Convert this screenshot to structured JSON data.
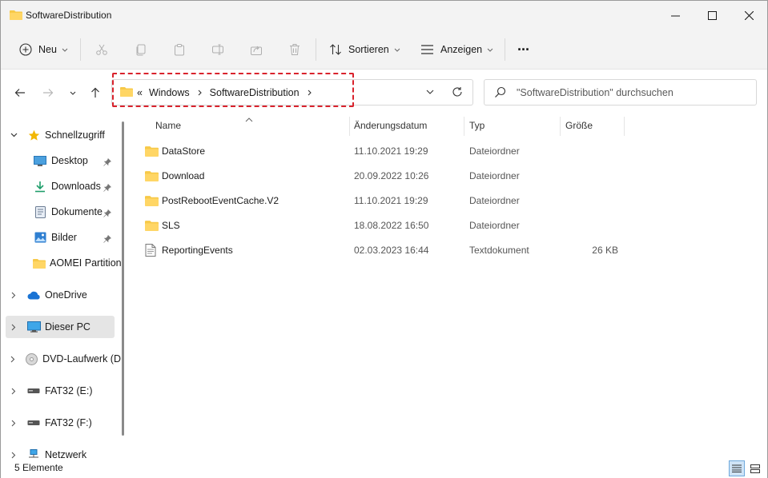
{
  "window": {
    "title": "SoftwareDistribution"
  },
  "toolbar": {
    "new_label": "Neu",
    "sort_label": "Sortieren",
    "view_label": "Anzeigen",
    "more_label": "···"
  },
  "address": {
    "overflow": "«",
    "crumbs": [
      "Windows",
      "SoftwareDistribution"
    ]
  },
  "search": {
    "placeholder": "\"SoftwareDistribution\" durchsuchen"
  },
  "sidebar": {
    "items": [
      {
        "label": "Schnellzugriff",
        "icon": "star-icon"
      },
      {
        "label": "Desktop",
        "icon": "desktop-icon"
      },
      {
        "label": "Downloads",
        "icon": "download-icon"
      },
      {
        "label": "Dokumente",
        "icon": "document-icon"
      },
      {
        "label": "Bilder",
        "icon": "pictures-icon"
      },
      {
        "label": "AOMEI Partition",
        "icon": "folder-icon"
      },
      {
        "label": "OneDrive",
        "icon": "cloud-icon"
      },
      {
        "label": "Dieser PC",
        "icon": "monitor-icon"
      },
      {
        "label": "DVD-Laufwerk (D",
        "icon": "dvd-icon"
      },
      {
        "label": "FAT32 (E:)",
        "icon": "drive-icon"
      },
      {
        "label": "FAT32 (F:)",
        "icon": "drive-icon"
      },
      {
        "label": "Netzwerk",
        "icon": "network-icon"
      }
    ]
  },
  "columns": {
    "name": "Name",
    "date": "Änderungsdatum",
    "type": "Typ",
    "size": "Größe"
  },
  "files": [
    {
      "name": "DataStore",
      "date": "11.10.2021 19:29",
      "type": "Dateiordner",
      "size": "",
      "icon": "folder-icon"
    },
    {
      "name": "Download",
      "date": "20.09.2022 10:26",
      "type": "Dateiordner",
      "size": "",
      "icon": "folder-icon"
    },
    {
      "name": "PostRebootEventCache.V2",
      "date": "11.10.2021 19:29",
      "type": "Dateiordner",
      "size": "",
      "icon": "folder-icon"
    },
    {
      "name": "SLS",
      "date": "18.08.2022 16:50",
      "type": "Dateiordner",
      "size": "",
      "icon": "folder-icon"
    },
    {
      "name": "ReportingEvents",
      "date": "02.03.2023 16:44",
      "type": "Textdokument",
      "size": "26 KB",
      "icon": "text-file-icon"
    }
  ],
  "status": {
    "count": "5 Elemente"
  },
  "colors": {
    "folder": "#f7c948",
    "highlight": "#d9232d",
    "accent": "#0067c0"
  }
}
